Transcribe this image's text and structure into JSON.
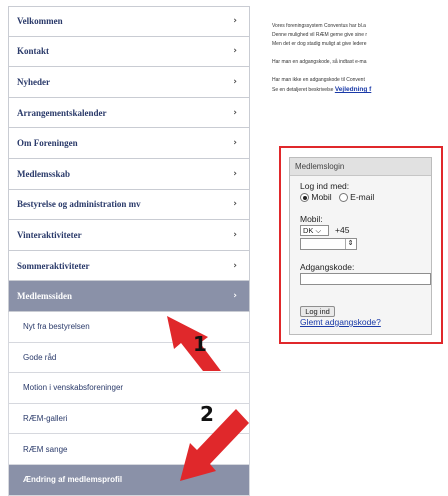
{
  "sidebar": {
    "items": [
      {
        "label": "Velkommen",
        "chevron": "›"
      },
      {
        "label": "Kontakt",
        "chevron": "›"
      },
      {
        "label": "Nyheder",
        "chevron": "›"
      },
      {
        "label": "Arrangementskalender",
        "chevron": "›"
      },
      {
        "label": "Om Foreningen",
        "chevron": "›"
      },
      {
        "label": "Medlemsskab",
        "chevron": "›"
      },
      {
        "label": "Bestyrelse og administration mv",
        "chevron": "›"
      },
      {
        "label": "Vinteraktiviteter",
        "chevron": "›"
      },
      {
        "label": "Sommeraktiviteter",
        "chevron": "›"
      },
      {
        "label": "Medlemssiden",
        "chevron": "›"
      }
    ],
    "sub_items": [
      {
        "label": "Nyt fra bestyrelsen"
      },
      {
        "label": "Gode råd"
      },
      {
        "label": "Motion i venskabsforeninger"
      },
      {
        "label": "RÆM-galleri"
      },
      {
        "label": "RÆM sange"
      },
      {
        "label": "Ændring af medlemsprofil"
      }
    ]
  },
  "content": {
    "line1": "Vores foreningssystem Conventus har bl.a",
    "line2": "Denne mulighed vil RÆM gerne give sine r",
    "line3": "Men det er dog stadig muligt at give ledere",
    "line4": "Har man en adgangskode, så indtast e-ma",
    "line5": "Har man ikke en adgangskode til Convent",
    "line6_prefix": "Se en detaljeret beskrivelse",
    "line6_link": "Vejledning f"
  },
  "login": {
    "title": "Medlemslogin",
    "login_with": "Log ind med:",
    "radio_mobile": "Mobil",
    "radio_email": "E-mail",
    "mobile_label": "Mobil:",
    "country_code": "DK",
    "country_caret": "⌵",
    "prefix": "+45",
    "spinner_glyph": "⇕",
    "password_label": "Adgangskode:",
    "button": "Log ind",
    "forgot": "Glemt adgangskode?"
  },
  "annotations": {
    "marker1": "1",
    "marker2": "2",
    "arrow_color": "#e0282b"
  },
  "colors": {
    "active_nav": "#8a91a8",
    "nav_text": "#2a3a6a",
    "link": "#1a3aa8",
    "highlight_border": "#e0282b"
  }
}
